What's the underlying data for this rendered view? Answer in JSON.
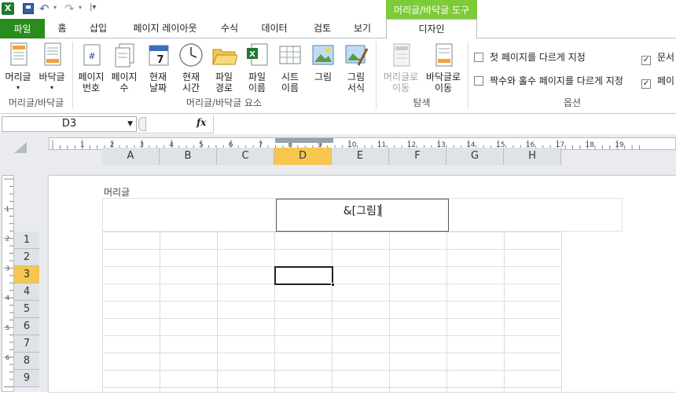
{
  "qat": {
    "icons": [
      "excel-icon",
      "save-icon",
      "undo-icon",
      "redo-icon",
      "customize-icon"
    ]
  },
  "context_band": "머리글/바닥글 도구",
  "tabs": [
    "파일",
    "홈",
    "삽입",
    "페이지 레이아웃",
    "수식",
    "데이터",
    "검토",
    "보기"
  ],
  "active_tab": "디자인",
  "ribbon": {
    "btn_header": "머리글",
    "btn_footer": "바닥글",
    "grp1": "머리글/바닥글",
    "btn_pagenum_1": "페이지",
    "btn_pagenum_2": "번호",
    "btn_pagecount_1": "페이지",
    "btn_pagecount_2": "수",
    "btn_date_1": "현재",
    "btn_date_2": "날짜",
    "btn_time_1": "현재",
    "btn_time_2": "시간",
    "btn_path_1": "파일",
    "btn_path_2": "경로",
    "btn_fname_1": "파일",
    "btn_fname_2": "이름",
    "btn_sheet_1": "시트",
    "btn_sheet_2": "이름",
    "btn_pic": "그림",
    "btn_picfmt_1": "그림",
    "btn_picfmt_2": "서식",
    "grp2": "머리글/바닥글 요소",
    "btn_goheader_1": "머리글로",
    "btn_goheader_2": "이동",
    "btn_gofooter_1": "바닥글로",
    "btn_gofooter_2": "이동",
    "grp3": "탐색",
    "opt_first": "첫 페이지를 다르게 지정",
    "opt_oddeven": "짝수와 홀수 페이지를 다르게 지정",
    "opt_doc": "문서",
    "opt_page": "페이",
    "grp4": "옵션"
  },
  "formula_bar": {
    "name_box": "D3",
    "fx": "fx"
  },
  "columns": [
    "A",
    "B",
    "C",
    "D",
    "E",
    "F",
    "G",
    "H"
  ],
  "rows": [
    "1",
    "2",
    "3",
    "4",
    "5",
    "6",
    "7",
    "8",
    "9"
  ],
  "ruler_numbers": [
    "1",
    "2",
    "3",
    "4",
    "5",
    "6",
    "7",
    "8",
    "9",
    "10",
    "11",
    "12",
    "13",
    "14",
    "15",
    "16",
    "17",
    "18",
    "19"
  ],
  "vruler_numbers": [
    "1",
    "2",
    "3",
    "4",
    "5",
    "6"
  ],
  "page": {
    "header_label": "머리글",
    "header_text": "&[그림]"
  }
}
